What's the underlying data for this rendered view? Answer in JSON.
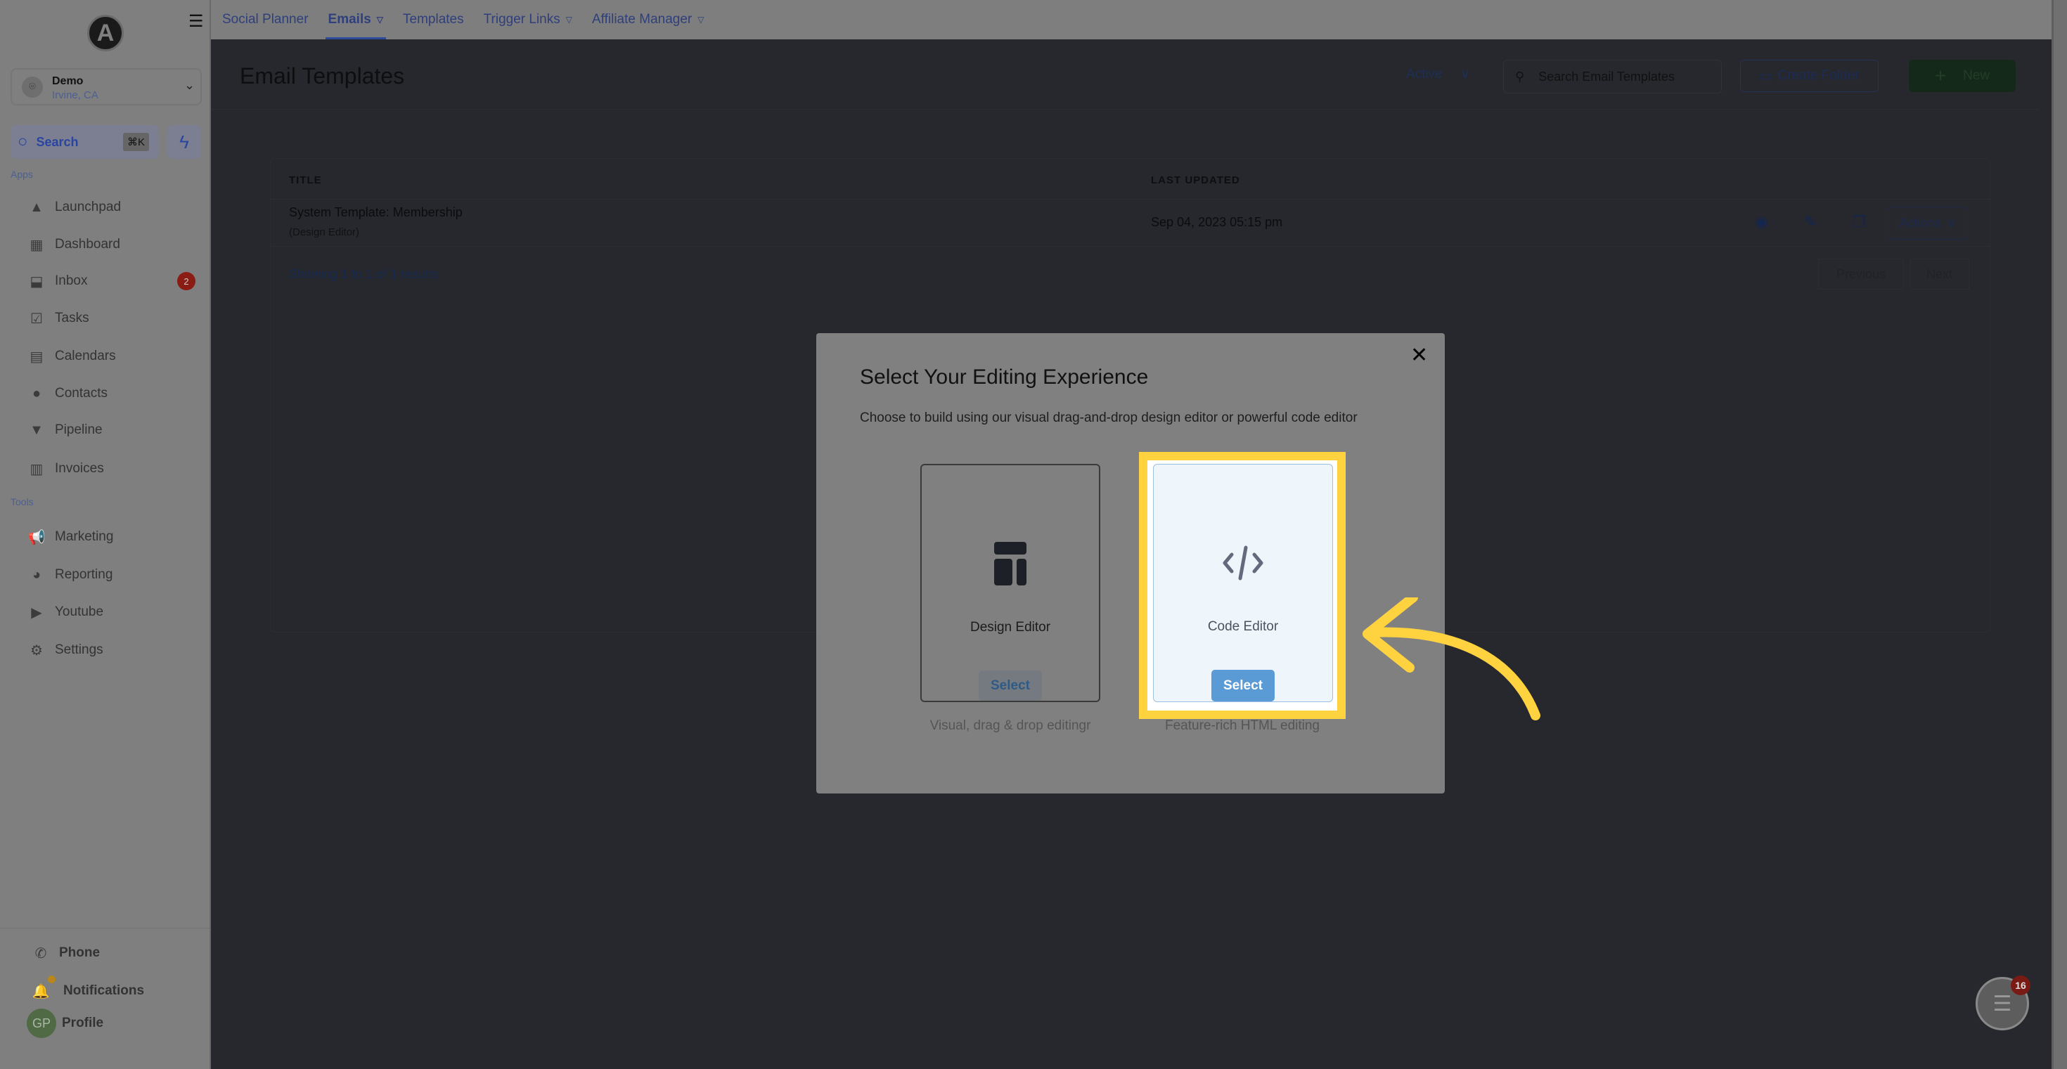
{
  "sidebar": {
    "logo_letter": "A",
    "location": {
      "name": "Demo",
      "city": "Irvine, CA"
    },
    "search": {
      "label": "Search",
      "shortcut": "⌘K"
    },
    "apps_label": "Apps",
    "apps": [
      {
        "label": "Launchpad",
        "icon": "rocket-icon"
      },
      {
        "label": "Dashboard",
        "icon": "dashboard-icon"
      },
      {
        "label": "Inbox",
        "icon": "inbox-icon",
        "badge": "2"
      },
      {
        "label": "Tasks",
        "icon": "tasks-icon"
      },
      {
        "label": "Calendars",
        "icon": "calendar-icon"
      },
      {
        "label": "Contacts",
        "icon": "contacts-icon"
      },
      {
        "label": "Pipeline",
        "icon": "pipeline-icon"
      },
      {
        "label": "Invoices",
        "icon": "invoice-icon"
      }
    ],
    "tools_label": "Tools",
    "tools": [
      {
        "label": "Marketing",
        "icon": "megaphone-icon"
      },
      {
        "label": "Reporting",
        "icon": "pie-chart-icon"
      },
      {
        "label": "Youtube",
        "icon": "youtube-icon"
      },
      {
        "label": "Settings",
        "icon": "gear-icon"
      }
    ],
    "bottom": {
      "phone": "Phone",
      "notifications": "Notifications",
      "profile": "Profile",
      "avatar_initials": "GP"
    }
  },
  "topnav": {
    "tabs": [
      {
        "label": "Social Planner"
      },
      {
        "label": "Emails",
        "active": true,
        "dropdown": true
      },
      {
        "label": "Templates"
      },
      {
        "label": "Trigger Links",
        "dropdown": true
      },
      {
        "label": "Affiliate Manager",
        "dropdown": true
      }
    ]
  },
  "page": {
    "title": "Email Templates",
    "status_filter": "Active",
    "search_placeholder": "Search Email Templates",
    "create_folder": "Create Folder",
    "new": "New"
  },
  "table": {
    "headers": {
      "title": "TITLE",
      "last_updated": "LAST UPDATED"
    },
    "rows": [
      {
        "title": "System Template: Membership",
        "subtitle": "(Design Editor)",
        "last_updated": "Sep 04, 2023 05:15 pm",
        "actions": "Actions"
      }
    ],
    "showing": "Showing 1 to 1 of 1 results",
    "previous": "Previous",
    "next": "Next"
  },
  "modal": {
    "title": "Select Your Editing Experience",
    "subtitle": "Choose to build using our visual drag-and-drop design editor or powerful code editor",
    "options": [
      {
        "label": "Design Editor",
        "button": "Select",
        "caption": "Visual, drag & drop editingr",
        "icon": "layout-icon"
      },
      {
        "label": "Code Editor",
        "button": "Select",
        "caption": "Feature-rich HTML editing",
        "icon": "code-icon",
        "highlighted": true
      }
    ]
  },
  "chat": {
    "badge": "16"
  },
  "colors": {
    "highlight": "#ffd23f",
    "select_active": "#5a9bd5",
    "brand_blue": "#2e4a9a"
  }
}
